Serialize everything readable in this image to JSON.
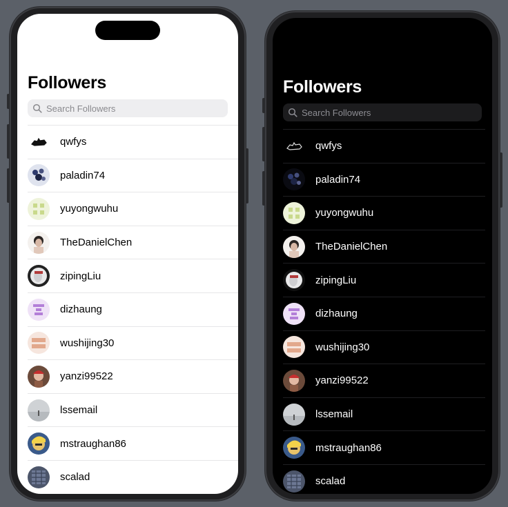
{
  "screens": [
    {
      "theme": "light",
      "title": "Followers",
      "search_placeholder": "Search Followers",
      "followers": [
        "qwfys",
        "paladin74",
        "yuyongwuhu",
        "TheDanielChen",
        "zipingLiu",
        "dizhaung",
        "wushijing30",
        "yanzi99522",
        "lssemail",
        "mstraughan86",
        "scalad"
      ]
    },
    {
      "theme": "dark",
      "title": "Followers",
      "search_placeholder": "Search Followers",
      "followers": [
        "qwfys",
        "paladin74",
        "yuyongwuhu",
        "TheDanielChen",
        "zipingLiu",
        "dizhaung",
        "wushijing30",
        "yanzi99522",
        "lssemail",
        "mstraughan86",
        "scalad"
      ]
    }
  ],
  "colors": {
    "background": "#5b6068",
    "light_screen": "#ffffff",
    "dark_screen": "#000000",
    "search_light": "#eeeef0",
    "search_dark": "#1c1c1e"
  },
  "icons": {
    "search": "magnifying-glass-icon"
  }
}
